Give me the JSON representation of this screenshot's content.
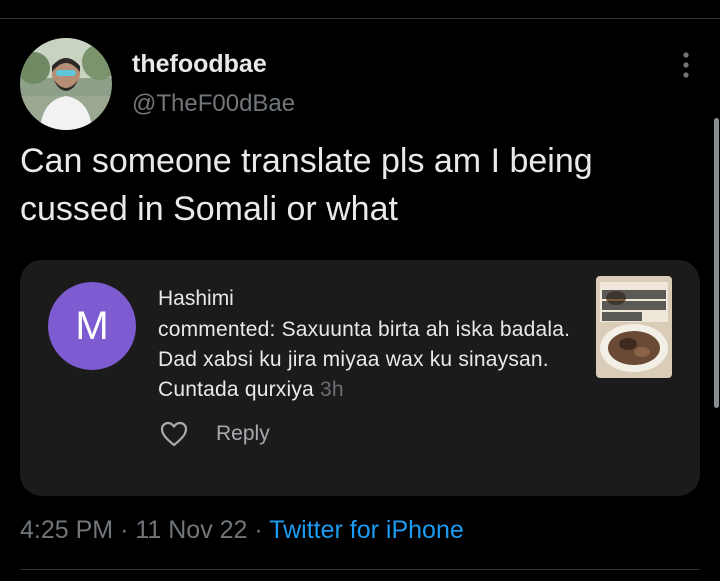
{
  "tweet": {
    "display_name": "thefoodbae",
    "handle": "@TheF00dBae",
    "text": "Can someone translate pls am I being cussed in Somali or what",
    "avatar_icon": "user-photo-avatar",
    "more_icon": "more-vertical-icon"
  },
  "quoted_comment": {
    "avatar_letter": "M",
    "avatar_color": "#7d5bd0",
    "commenter": "Hashimi",
    "comment": "commented: Saxuunta birta ah iska badala. Dad xabsi ku jira miyaa wax ku sinaysan. Cuntada qurxiya",
    "time": "3h",
    "thumbnail_caption": "10 TO SOMALI RESTAURANTS IN LONDON!",
    "like_icon": "heart-outline-icon",
    "reply_label": "Reply"
  },
  "meta": {
    "time": "4:25 PM",
    "separator": "·",
    "date": "11 Nov 22",
    "source": "Twitter for iPhone"
  },
  "colors": {
    "background": "#000000",
    "link": "#1d9bf0",
    "secondary_text": "#71767b",
    "card": "#1b1b1c"
  }
}
